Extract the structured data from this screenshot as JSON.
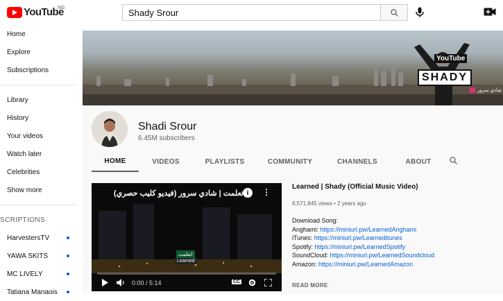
{
  "header": {
    "logo_text": "YouTube",
    "country_code": "NG",
    "search_value": "Shady Srour",
    "search_icon": "search-icon",
    "mic_icon": "mic-icon",
    "create_icon": "video-create-icon"
  },
  "sidebar": {
    "primary": [
      {
        "label": "Home"
      },
      {
        "label": "Explore"
      },
      {
        "label": "Subscriptions"
      }
    ],
    "secondary": [
      {
        "label": "Library"
      },
      {
        "label": "History"
      },
      {
        "label": "Your videos"
      },
      {
        "label": "Watch later"
      },
      {
        "label": "Celebrities"
      },
      {
        "label": "Show more"
      }
    ],
    "subscriptions_header": "SCRIPTIONS",
    "subscriptions": [
      {
        "label": "HarvestersTV"
      },
      {
        "label": "YAWA SKITS"
      },
      {
        "label": "MC LIVELY"
      },
      {
        "label": "Tatiana Manaois"
      }
    ]
  },
  "banner": {
    "youtube_tag": "YouTube",
    "shady_tag": "SHADY",
    "instagram_text": "شادي سرور"
  },
  "channel": {
    "name": "Shadi Srour",
    "subscribers": "6.45M subscribers",
    "tabs": [
      "HOME",
      "VIDEOS",
      "PLAYLISTS",
      "COMMUNITY",
      "CHANNELS",
      "ABOUT"
    ],
    "active_tab": "HOME"
  },
  "featured_video": {
    "player_title": "اتعلمت | شادي سرور (فيديو كليب حصري)",
    "sign_text": "اتعلمت",
    "sign_text_2": "Learned",
    "time": "0:00 / 5:14",
    "cc_label": "CC",
    "title": "Learned | Shady (Official Music Video)",
    "meta": "8,571,845 views • 2 years ago",
    "description": [
      {
        "prefix": "Download Song:",
        "link": ""
      },
      {
        "prefix": "Anghami: ",
        "link": "https://miniurl.pw/LearnedAnghami"
      },
      {
        "prefix": "iTunes: ",
        "link": "https://miniurl.pw/Learneditunes"
      },
      {
        "prefix": "Spotify: ",
        "link": "https://miniurl.pw/LearnedSpotify"
      },
      {
        "prefix": "SoundCloud: ",
        "link": "https://miniurl.pw/LearnedSoundcloud"
      },
      {
        "prefix": "Amazon: ",
        "link": "https://miniurl.pw/LearnedAmazon"
      }
    ],
    "read_more": "READ MORE"
  },
  "colors": {
    "brand_red": "#ff0000",
    "link_blue": "#065fd4",
    "muted_text": "#606060"
  }
}
